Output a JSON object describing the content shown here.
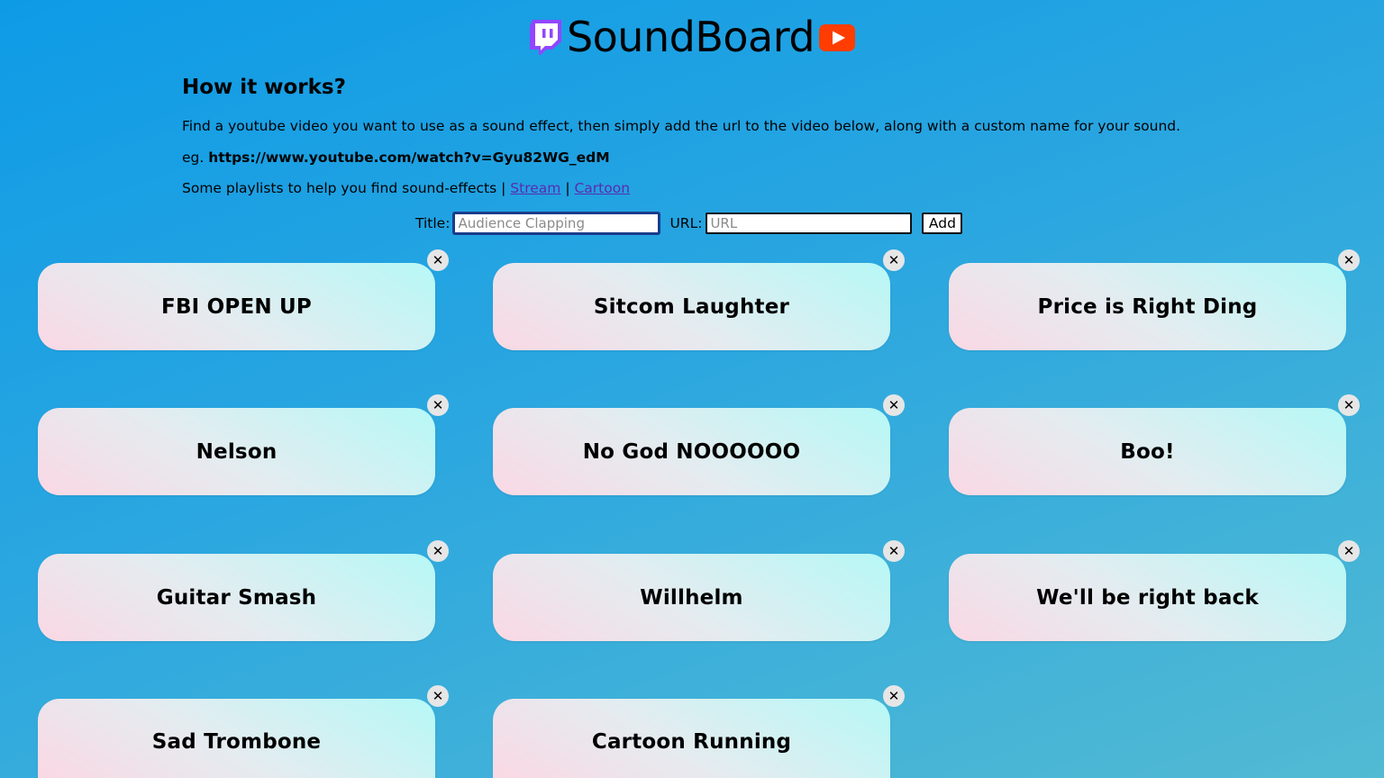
{
  "header": {
    "title": "SoundBoard",
    "left_icon": "twitch-icon",
    "right_icon": "youtube-icon",
    "twitch_color": "#9146ff",
    "youtube_color": "#ff3d00"
  },
  "how": {
    "heading": "How it works?",
    "instruction": "Find a youtube video you want to use as a sound effect, then simply add the url to the video below, along with a custom name for your sound.",
    "example_prefix": "eg. ",
    "example_url": "https://www.youtube.com/watch?v=Gyu82WG_edM",
    "playlists_text": "Some playlists to help you find sound-effects | ",
    "separator": " | ",
    "link_stream": "Stream",
    "link_cartoon": "Cartoon"
  },
  "form": {
    "title_label": "Title:",
    "title_placeholder": "Audience Clapping",
    "url_label": "URL:",
    "url_placeholder": "URL",
    "add_label": "Add"
  },
  "sounds": [
    {
      "label": "FBI OPEN UP"
    },
    {
      "label": "Sitcom Laughter"
    },
    {
      "label": "Price is Right Ding"
    },
    {
      "label": "Nelson"
    },
    {
      "label": "No God NOOOOOO"
    },
    {
      "label": "Boo!"
    },
    {
      "label": "Guitar Smash"
    },
    {
      "label": "Willhelm"
    },
    {
      "label": "We'll be right back"
    },
    {
      "label": "Sad Trombone"
    },
    {
      "label": "Cartoon Running"
    }
  ],
  "delete_symbol": "✕"
}
